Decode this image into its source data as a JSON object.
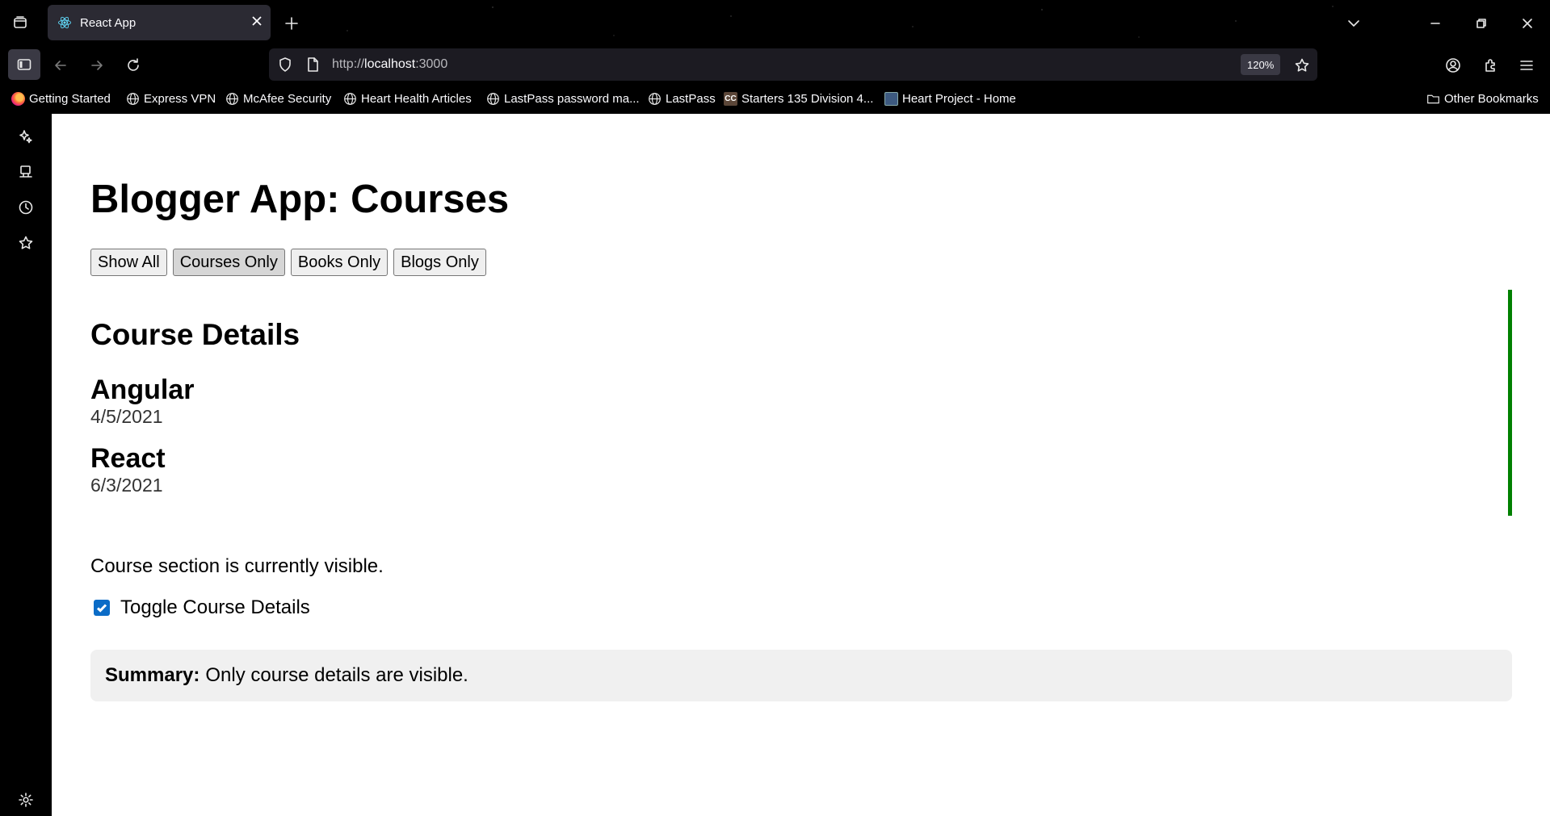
{
  "browser": {
    "tab": {
      "title": "React App",
      "favicon": "react-logo-icon"
    },
    "url": {
      "prefix": "http://",
      "host": "localhost",
      "port": ":3000"
    },
    "zoom": "120%",
    "bookmarks": [
      {
        "label": "Getting Started",
        "icon": "firefox-icon"
      },
      {
        "label": "Express VPN",
        "icon": "globe-icon"
      },
      {
        "label": "McAfee Security",
        "icon": "globe-icon"
      },
      {
        "label": "Heart Health Articles",
        "icon": "globe-icon"
      },
      {
        "label": "LastPass password ma...",
        "icon": "globe-icon"
      },
      {
        "label": "LastPass",
        "icon": "globe-icon"
      },
      {
        "label": "Starters 135 Division 4...",
        "icon": "codechef-icon"
      },
      {
        "label": "Heart Project - Home",
        "icon": "terminal-icon"
      }
    ],
    "other_bookmarks": "Other Bookmarks"
  },
  "page": {
    "title": "Blogger App: Courses",
    "filters": [
      {
        "label": "Show All",
        "active": false
      },
      {
        "label": "Courses Only",
        "active": true
      },
      {
        "label": "Books Only",
        "active": false
      },
      {
        "label": "Blogs Only",
        "active": false
      }
    ],
    "course_section": {
      "heading": "Course Details",
      "accent_color": "#008000",
      "courses": [
        {
          "name": "Angular",
          "date": "4/5/2021"
        },
        {
          "name": "React",
          "date": "6/3/2021"
        }
      ]
    },
    "status": "Course section is currently visible.",
    "toggle": {
      "label": "Toggle Course Details",
      "checked": true
    },
    "summary": {
      "label": "Summary:",
      "text": "Only course details are visible."
    }
  }
}
